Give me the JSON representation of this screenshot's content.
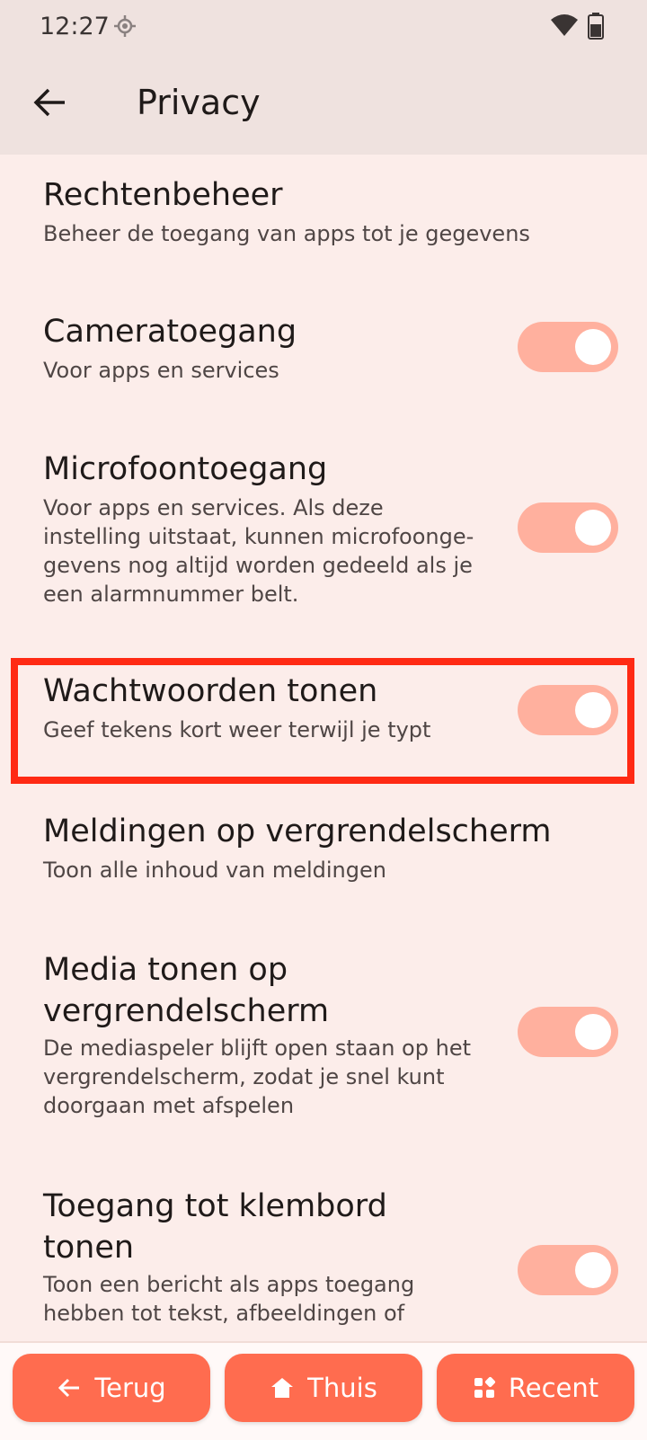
{
  "status": {
    "time": "12:27"
  },
  "appbar": {
    "title": "Privacy"
  },
  "items": [
    {
      "title": "Rechtenbeheer",
      "summary": "Beheer de toegang van apps tot je gegevens",
      "toggle": null
    },
    {
      "title": "Cameratoegang",
      "summary": "Voor apps en services",
      "toggle": true
    },
    {
      "title": "Microfoontoegang",
      "summary": "Voor apps en services. Als deze instelling uitstaat, kunnen microfoonge­gevens nog altijd worden gedeeld als je een alarmnummer belt.",
      "toggle": true
    },
    {
      "title": "Wachtwoorden tonen",
      "summary": "Geef tekens kort weer terwijl je typt",
      "toggle": true
    },
    {
      "title": "Meldingen op vergrendelscherm",
      "summary": "Toon alle inhoud van meldingen",
      "toggle": null
    },
    {
      "title": "Media tonen op vergrendelscherm",
      "summary": "De mediaspeler blijft open staan op het vergrendelscherm, zodat je snel kunt doorgaan met afspelen",
      "toggle": true
    },
    {
      "title": "Toegang tot klembord tonen",
      "summary": "Toon een bericht als apps toegang hebben tot tekst, afbeeldingen of",
      "toggle": true
    }
  ],
  "nav": {
    "back": "Terug",
    "home": "Thuis",
    "recent": "Recent"
  },
  "colors": {
    "accent": "#ff6c4f",
    "switch_track": "#ffb09e",
    "highlight": "#ff2a14",
    "background": "#fcedea"
  }
}
